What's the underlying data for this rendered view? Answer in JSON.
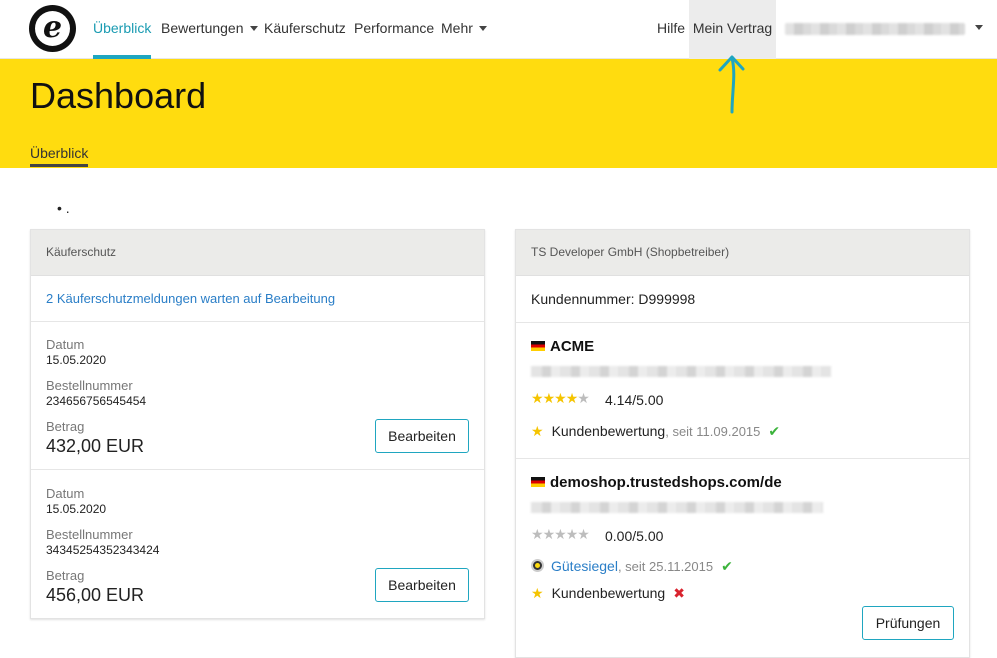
{
  "nav": {
    "logo_letter": "e",
    "items": [
      {
        "label": "Überblick"
      },
      {
        "label": "Bewertungen"
      },
      {
        "label": "Käuferschutz"
      },
      {
        "label": "Performance"
      },
      {
        "label": "Mehr"
      }
    ],
    "help": "Hilfe",
    "contract": "Mein Vertrag"
  },
  "header": {
    "title": "Dashboard",
    "subtab": "Überblick"
  },
  "bullet_text": ".",
  "buyer_protection": {
    "title": "Käuferschutz",
    "pending_link": "2 Käuferschutzmeldungen warten auf Bearbeitung",
    "entries": [
      {
        "date_label": "Datum",
        "date": "15.05.2020",
        "order_label": "Bestellnummer",
        "order": "234656756545454",
        "amount_label": "Betrag",
        "amount": "432,00 EUR",
        "action": "Bearbeiten"
      },
      {
        "date_label": "Datum",
        "date": "15.05.2020",
        "order_label": "Bestellnummer",
        "order": "34345254352343424",
        "amount_label": "Betrag",
        "amount": "456,00 EUR",
        "action": "Bearbeiten"
      }
    ]
  },
  "account": {
    "title": "TS Developer GmbH (Shopbetreiber)",
    "customer_number": "Kundennummer: D999998",
    "shops": [
      {
        "name": "ACME",
        "rating_stars": 4,
        "rating": "4.14/5.00",
        "reviews_label": "Kundenbewertung",
        "reviews_since": ", seit 11.09.2015",
        "reviews_status": "✔"
      },
      {
        "name": "demoshop.trustedshops.com/de",
        "rating_stars": 0,
        "rating": "0.00/5.00",
        "seal_label": "Gütesiegel",
        "seal_since": ", seit 25.11.2015",
        "seal_status": "✔",
        "reviews_label": "Kundenbewertung",
        "reviews_status": "✖",
        "action": "Prüfungen"
      }
    ]
  },
  "colors": {
    "accent": "#1fa6c0",
    "header_yellow": "#ffdc0f",
    "link": "#2a7ec7",
    "star": "#f5c400",
    "success": "#3bb33b",
    "error": "#d9232e"
  }
}
